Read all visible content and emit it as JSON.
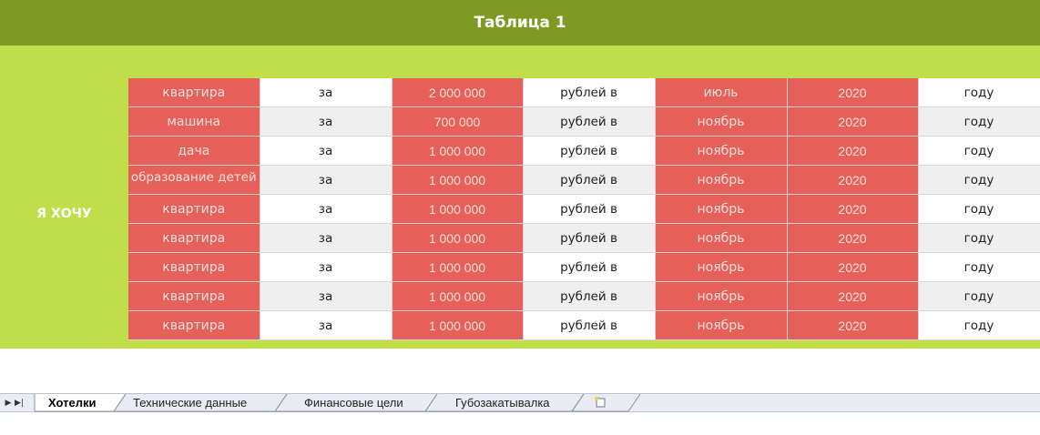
{
  "header": {
    "title": "Таблица 1"
  },
  "side_label": "Я ХОЧУ",
  "rows": [
    [
      "квартира",
      "за",
      "2 000 000",
      "рублей в",
      "июль",
      "2020",
      "году"
    ],
    [
      "машина",
      "за",
      "700 000",
      "рублей в",
      "ноябрь",
      "2020",
      "году"
    ],
    [
      "дача",
      "за",
      "1 000 000",
      "рублей в",
      "ноябрь",
      "2020",
      "году"
    ],
    [
      "образование детей",
      "за",
      "1 000 000",
      "рублей в",
      "ноябрь",
      "2020",
      "году"
    ],
    [
      "квартира",
      "за",
      "1 000 000",
      "рублей в",
      "ноябрь",
      "2020",
      "году"
    ],
    [
      "квартира",
      "за",
      "1 000 000",
      "рублей в",
      "ноябрь",
      "2020",
      "году"
    ],
    [
      "квартира",
      "за",
      "1 000 000",
      "рублей в",
      "ноябрь",
      "2020",
      "году"
    ],
    [
      "квартира",
      "за",
      "1 000 000",
      "рублей в",
      "ноябрь",
      "2020",
      "году"
    ],
    [
      "квартира",
      "за",
      "1 000 000",
      "рублей в",
      "ноябрь",
      "2020",
      "году"
    ]
  ],
  "sheet_tabs": [
    {
      "label": "Хотелки",
      "active": true
    },
    {
      "label": "Технические данные",
      "active": false
    },
    {
      "label": "Финансовые цели",
      "active": false
    },
    {
      "label": "Губозакатывалка",
      "active": false
    }
  ],
  "nav": {
    "next_icon": "play-right-icon",
    "last_icon": "skip-last-icon",
    "new_sheet_icon": "new-sheet-icon"
  },
  "colors": {
    "title_bg": "#7f9a22",
    "area_bg": "#c0de4a",
    "cell_red": "#e65f58"
  }
}
